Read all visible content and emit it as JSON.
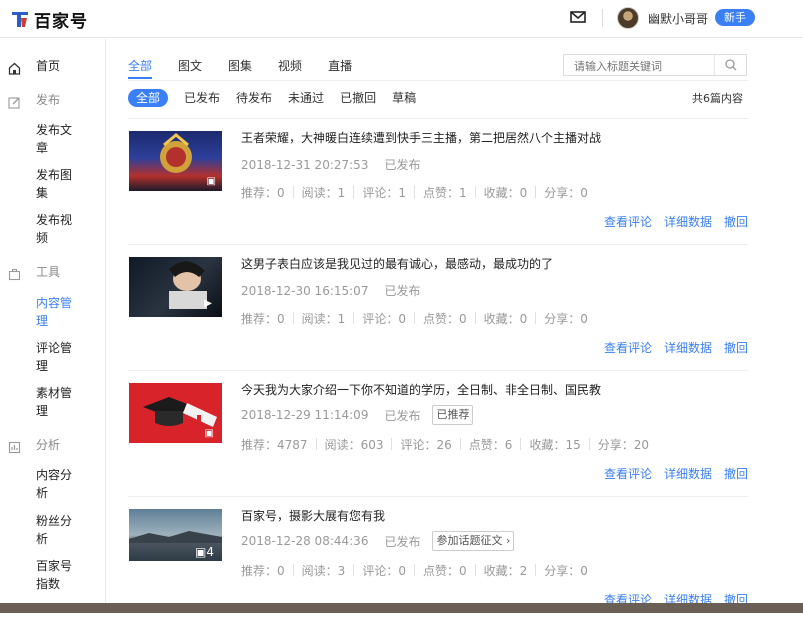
{
  "header": {
    "logo_text": "百家号",
    "user_name": "幽默小哥哥",
    "new_badge": "新手"
  },
  "sidebar": {
    "home": "首页",
    "publish_section": "发布",
    "publish_article": "发布文章",
    "publish_gallery": "发布图集",
    "publish_video": "发布视频",
    "tools_section": "工具",
    "content_mgmt": "内容管理",
    "comment_mgmt": "评论管理",
    "material_mgmt": "素材管理",
    "analysis_section": "分析",
    "content_analysis": "内容分析",
    "fans_analysis": "粉丝分析",
    "baijiahao_index": "百家号指数"
  },
  "tabs": [
    "全部",
    "图文",
    "图集",
    "视频",
    "直播"
  ],
  "active_tab": "全部",
  "search": {
    "placeholder": "请输入标题关键词"
  },
  "filters": [
    "全部",
    "已发布",
    "待发布",
    "未通过",
    "已撤回",
    "草稿"
  ],
  "active_filter": "全部",
  "total_count": "共6篇内容",
  "labels": {
    "recommend": "推荐：",
    "read": "阅读：",
    "comment": "评论：",
    "like": "点赞：",
    "favorite": "收藏：",
    "share": "分享：",
    "view_comments": "查看评论",
    "detail_data": "详细数据",
    "withdraw": "撤回"
  },
  "articles": [
    {
      "title": "王者荣耀，大神暖白连续遭到快手三主播，第二把居然八个主播对战",
      "date": "2018-12-31 20:27:53",
      "status": "已发布",
      "tag": "",
      "recommend": "0",
      "read": "1",
      "comment": "1",
      "like": "1",
      "favorite": "0",
      "share": "0"
    },
    {
      "title": "这男子表白应该是我见过的最有诚心，最感动，最成功的了",
      "date": "2018-12-30 16:15:07",
      "status": "已发布",
      "tag": "",
      "recommend": "0",
      "read": "1",
      "comment": "0",
      "like": "0",
      "favorite": "0",
      "share": "0"
    },
    {
      "title": "今天我为大家介绍一下你不知道的学历，全日制、非全日制、国民教",
      "date": "2018-12-29 11:14:09",
      "status": "已发布",
      "tag": "已推荐",
      "recommend": "4787",
      "read": "603",
      "comment": "26",
      "like": "6",
      "favorite": "15",
      "share": "20"
    },
    {
      "title": "百家号，摄影大展有您有我",
      "date": "2018-12-28 08:44:36",
      "status": "已发布",
      "tag": "参加话题征文",
      "recommend": "0",
      "read": "3",
      "comment": "0",
      "like": "0",
      "favorite": "2",
      "share": "0",
      "thumb_count": "4"
    }
  ],
  "colors": {
    "accent": "#3a7ff5"
  }
}
